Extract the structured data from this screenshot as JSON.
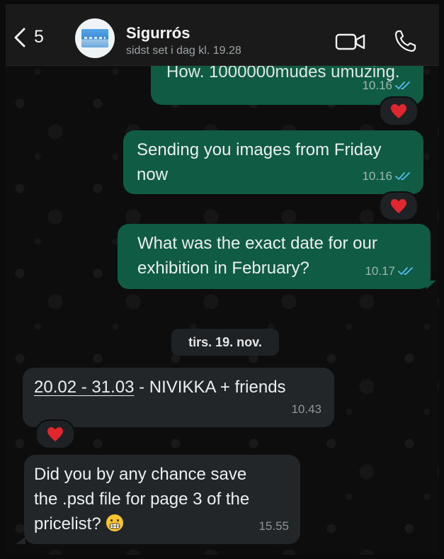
{
  "header": {
    "back_count": "5",
    "contact_name": "Sigurrós",
    "status": "sidst set i dag kl. 19.28"
  },
  "messages": [
    {
      "type": "out",
      "text_partial": "How. 1000000mudes umuzing.",
      "time": "10.16",
      "reaction": "heart",
      "read": true
    },
    {
      "type": "out",
      "lines": [
        "Sending you images from Friday",
        "now"
      ],
      "time": "10.16",
      "reaction": "heart",
      "read": true
    },
    {
      "type": "out",
      "lines": [
        "What was the exact date for our",
        "exhibition in February?"
      ],
      "time": "10.17",
      "read": true
    },
    {
      "type": "in",
      "link_text": "20.02 - 31.03",
      "rest_text": " - NIVIKKA + friends",
      "time": "10.43",
      "reaction": "heart"
    },
    {
      "type": "in",
      "lines": [
        "Did you by any chance save",
        "the .psd file for page 3 of the",
        "pricelist?"
      ],
      "emoji": "grimacing-face",
      "time": "15.55"
    }
  ],
  "date_separator": "tirs. 19. nov.",
  "colors": {
    "outgoing_bubble": "#0f5b44",
    "incoming_bubble": "#232628",
    "read_ticks": "#53bdeb",
    "heart": "#e0262e"
  },
  "icons": [
    "chevron-left-icon",
    "video-camera-icon",
    "phone-icon",
    "double-check-icon",
    "heart-icon",
    "grimacing-emoji-icon"
  ]
}
